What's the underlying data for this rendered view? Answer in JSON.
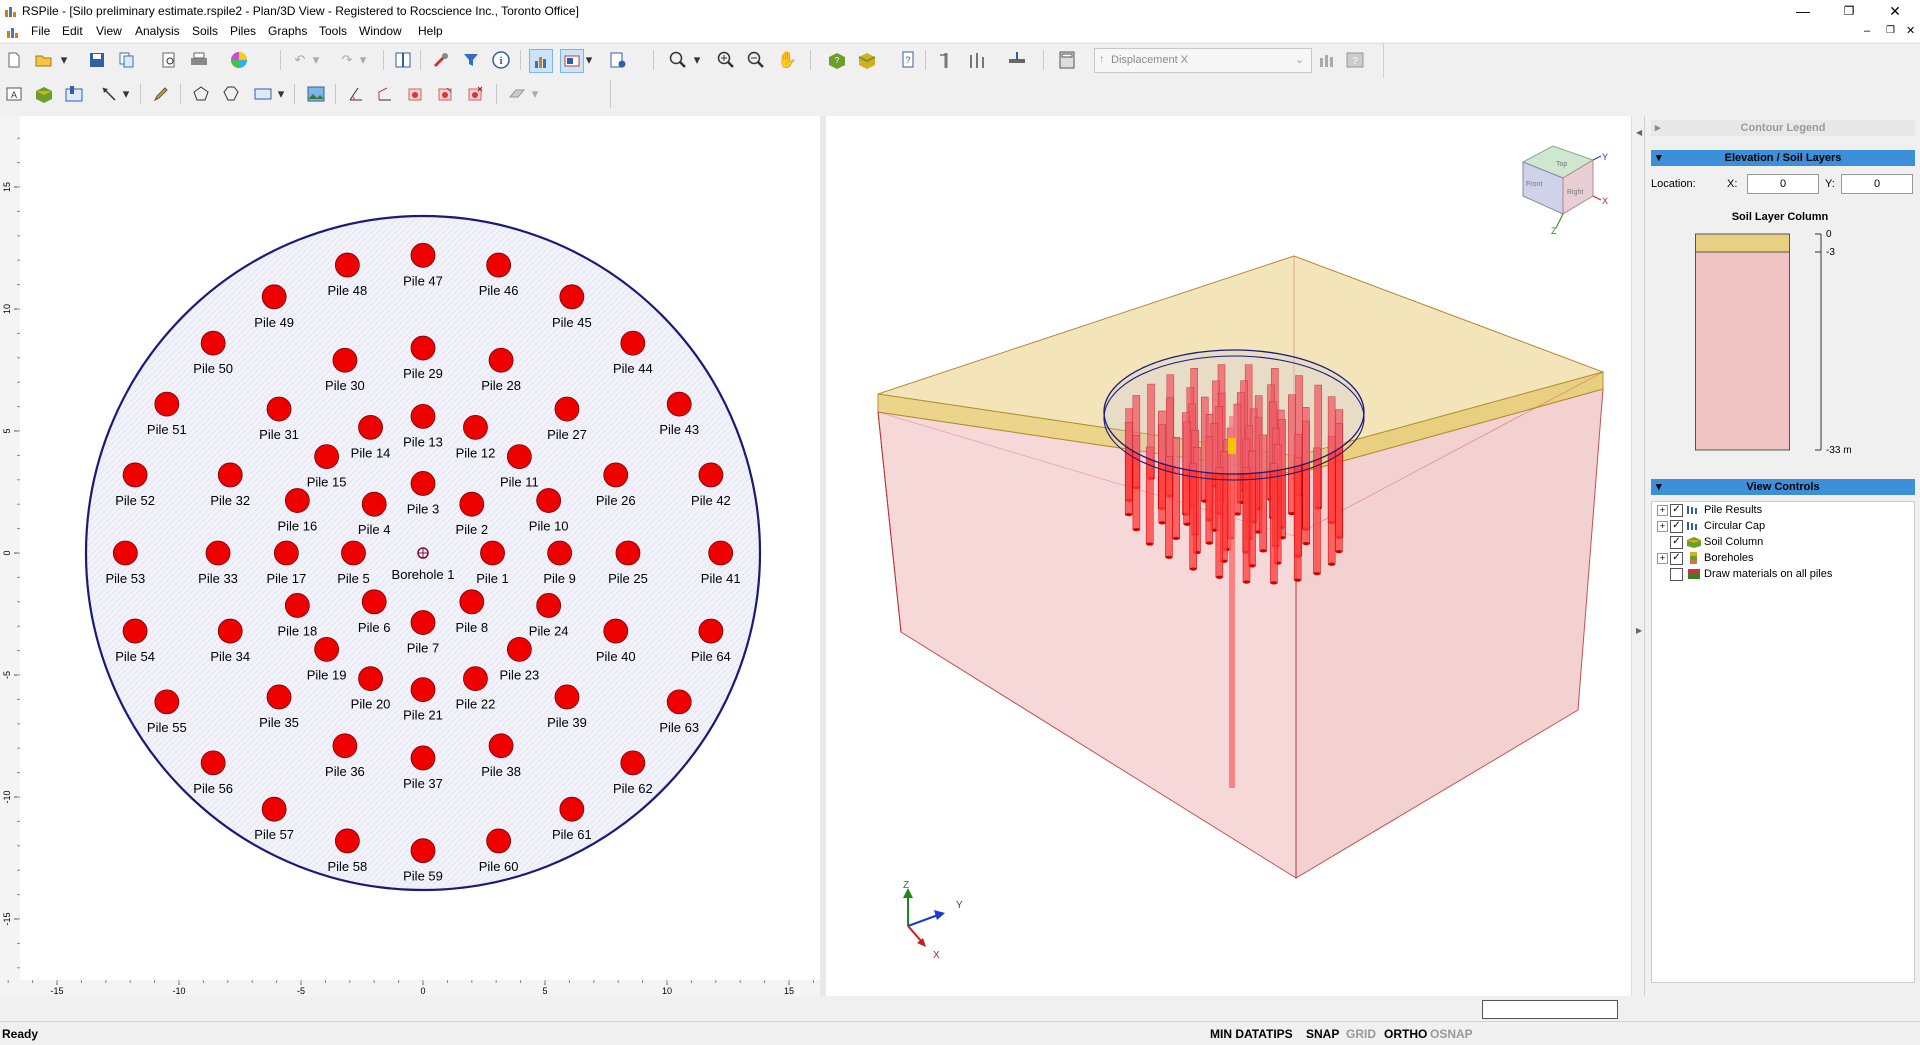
{
  "window": {
    "title": "RSPile - [Silo preliminary estimate.rspile2 - Plan/3D View - Registered to Rocscience Inc., Toronto Office]",
    "minimize_glyph": "—",
    "restore_glyph": "❐",
    "close_glyph": "✕"
  },
  "menu": [
    "File",
    "Edit",
    "View",
    "Analysis",
    "Soils",
    "Piles",
    "Graphs",
    "Tools",
    "Window",
    "Help"
  ],
  "toolbar": {
    "result_type": "Displacement X"
  },
  "plan": {
    "borehole_label": "Borehole 1",
    "x_ticks": [
      {
        "v": -15,
        "t": "-15"
      },
      {
        "v": -10,
        "t": "-10"
      },
      {
        "v": -5,
        "t": "-5"
      },
      {
        "v": 0,
        "t": "0"
      },
      {
        "v": 5,
        "t": "5"
      },
      {
        "v": 10,
        "t": "10"
      },
      {
        "v": 15,
        "t": "15"
      }
    ],
    "y_ticks": [
      {
        "v": 15,
        "t": "15"
      },
      {
        "v": 10,
        "t": "10"
      },
      {
        "v": 5,
        "t": "5"
      },
      {
        "v": 0,
        "t": "0"
      },
      {
        "v": -5,
        "t": "-5"
      },
      {
        "v": -10,
        "t": "-10"
      },
      {
        "v": -15,
        "t": "-15"
      }
    ],
    "piles": [
      {
        "n": "Pile 1",
        "x": 2.85,
        "y": 0
      },
      {
        "n": "Pile 2",
        "x": 2.0,
        "y": 2.0
      },
      {
        "n": "Pile 3",
        "x": 0,
        "y": 2.85
      },
      {
        "n": "Pile 4",
        "x": -2.0,
        "y": 2.0
      },
      {
        "n": "Pile 5",
        "x": -2.85,
        "y": 0
      },
      {
        "n": "Pile 6",
        "x": -2.0,
        "y": -2.0
      },
      {
        "n": "Pile 7",
        "x": 0,
        "y": -2.85
      },
      {
        "n": "Pile 8",
        "x": 2.0,
        "y": -2.0
      },
      {
        "n": "Pile 9",
        "x": 5.6,
        "y": 0
      },
      {
        "n": "Pile 10",
        "x": 5.15,
        "y": 2.15
      },
      {
        "n": "Pile 11",
        "x": 3.95,
        "y": 3.95
      },
      {
        "n": "Pile 12",
        "x": 2.15,
        "y": 5.15
      },
      {
        "n": "Pile 13",
        "x": 0,
        "y": 5.6
      },
      {
        "n": "Pile 14",
        "x": -2.15,
        "y": 5.15
      },
      {
        "n": "Pile 15",
        "x": -3.95,
        "y": 3.95
      },
      {
        "n": "Pile 16",
        "x": -5.15,
        "y": 2.15
      },
      {
        "n": "Pile 17",
        "x": -5.6,
        "y": 0
      },
      {
        "n": "Pile 18",
        "x": -5.15,
        "y": -2.15
      },
      {
        "n": "Pile 19",
        "x": -3.95,
        "y": -3.95
      },
      {
        "n": "Pile 20",
        "x": -2.15,
        "y": -5.15
      },
      {
        "n": "Pile 21",
        "x": 0,
        "y": -5.6
      },
      {
        "n": "Pile 22",
        "x": 2.15,
        "y": -5.15
      },
      {
        "n": "Pile 23",
        "x": 3.95,
        "y": -3.95
      },
      {
        "n": "Pile 24",
        "x": 5.15,
        "y": -2.15
      },
      {
        "n": "Pile 25",
        "x": 8.4,
        "y": 0
      },
      {
        "n": "Pile 26",
        "x": 7.9,
        "y": 3.2
      },
      {
        "n": "Pile 27",
        "x": 5.9,
        "y": 5.9
      },
      {
        "n": "Pile 28",
        "x": 3.2,
        "y": 7.9
      },
      {
        "n": "Pile 29",
        "x": 0,
        "y": 8.4
      },
      {
        "n": "Pile 30",
        "x": -3.2,
        "y": 7.9
      },
      {
        "n": "Pile 31",
        "x": -5.9,
        "y": 5.9
      },
      {
        "n": "Pile 32",
        "x": -7.9,
        "y": 3.2
      },
      {
        "n": "Pile 33",
        "x": -8.4,
        "y": 0
      },
      {
        "n": "Pile 34",
        "x": -7.9,
        "y": -3.2
      },
      {
        "n": "Pile 35",
        "x": -5.9,
        "y": -5.9
      },
      {
        "n": "Pile 36",
        "x": -3.2,
        "y": -7.9
      },
      {
        "n": "Pile 37",
        "x": 0,
        "y": -8.4
      },
      {
        "n": "Pile 38",
        "x": 3.2,
        "y": -7.9
      },
      {
        "n": "Pile 39",
        "x": 5.9,
        "y": -5.9
      },
      {
        "n": "Pile 40",
        "x": 7.9,
        "y": -3.2
      },
      {
        "n": "Pile 41",
        "x": 12.2,
        "y": 0
      },
      {
        "n": "Pile 42",
        "x": 11.8,
        "y": 3.2
      },
      {
        "n": "Pile 43",
        "x": 10.5,
        "y": 6.1
      },
      {
        "n": "Pile 44",
        "x": 8.6,
        "y": 8.6
      },
      {
        "n": "Pile 45",
        "x": 6.1,
        "y": 10.5
      },
      {
        "n": "Pile 46",
        "x": 3.1,
        "y": 11.8
      },
      {
        "n": "Pile 47",
        "x": 0,
        "y": 12.2
      },
      {
        "n": "Pile 48",
        "x": -3.1,
        "y": 11.8
      },
      {
        "n": "Pile 49",
        "x": -6.1,
        "y": 10.5
      },
      {
        "n": "Pile 50",
        "x": -8.6,
        "y": 8.6
      },
      {
        "n": "Pile 51",
        "x": -10.5,
        "y": 6.1
      },
      {
        "n": "Pile 52",
        "x": -11.8,
        "y": 3.2
      },
      {
        "n": "Pile 53",
        "x": -12.2,
        "y": 0
      },
      {
        "n": "Pile 54",
        "x": -11.8,
        "y": -3.2
      },
      {
        "n": "Pile 55",
        "x": -10.5,
        "y": -6.1
      },
      {
        "n": "Pile 56",
        "x": -8.6,
        "y": -8.6
      },
      {
        "n": "Pile 57",
        "x": -6.1,
        "y": -10.5
      },
      {
        "n": "Pile 58",
        "x": -3.1,
        "y": -11.8
      },
      {
        "n": "Pile 59",
        "x": 0,
        "y": -12.2
      },
      {
        "n": "Pile 60",
        "x": 3.1,
        "y": -11.8
      },
      {
        "n": "Pile 61",
        "x": 6.1,
        "y": -10.5
      },
      {
        "n": "Pile 62",
        "x": 8.6,
        "y": -8.6
      },
      {
        "n": "Pile 63",
        "x": 10.5,
        "y": -6.1
      },
      {
        "n": "Pile 64",
        "x": 11.8,
        "y": -3.2
      }
    ]
  },
  "view3d": {
    "axis_x": "X",
    "axis_y": "Y",
    "axis_z": "Z",
    "cube_front": "Front",
    "cube_right": "Right",
    "cube_top": "Top"
  },
  "sidebar": {
    "contour_legend": "Contour Legend",
    "elevation_title": "Elevation / Soil Layers",
    "location_label": "Location:",
    "x_label": "X:",
    "y_label": "Y:",
    "x_value": "0",
    "y_value": "0",
    "soil_column_title": "Soil Layer Column",
    "elev_top": "0",
    "elev_mid": "-3",
    "elev_bottom": "-33 m",
    "view_controls_title": "View Controls",
    "tree": [
      {
        "label": "Pile Results",
        "checked": true,
        "expand": true
      },
      {
        "label": "Circular Cap",
        "checked": true,
        "expand": true
      },
      {
        "label": "Soil Column",
        "checked": true,
        "expand": false
      },
      {
        "label": "Boreholes",
        "checked": true,
        "expand": true
      },
      {
        "label": "Draw materials on all piles",
        "checked": false,
        "expand": false
      }
    ]
  },
  "status": {
    "ready": "Ready",
    "min_datatips": "MIN DATATIPS",
    "snap": "SNAP",
    "grid": "GRID",
    "ortho": "ORTHO",
    "osnap": "OSNAP"
  },
  "colors": {
    "pile_fill": "#ee0000",
    "cap_outline": "#1a1a7a",
    "soil_top": "#e8d08a",
    "soil_main": "#f1c4c4",
    "header_blue": "#3c8fd8"
  }
}
